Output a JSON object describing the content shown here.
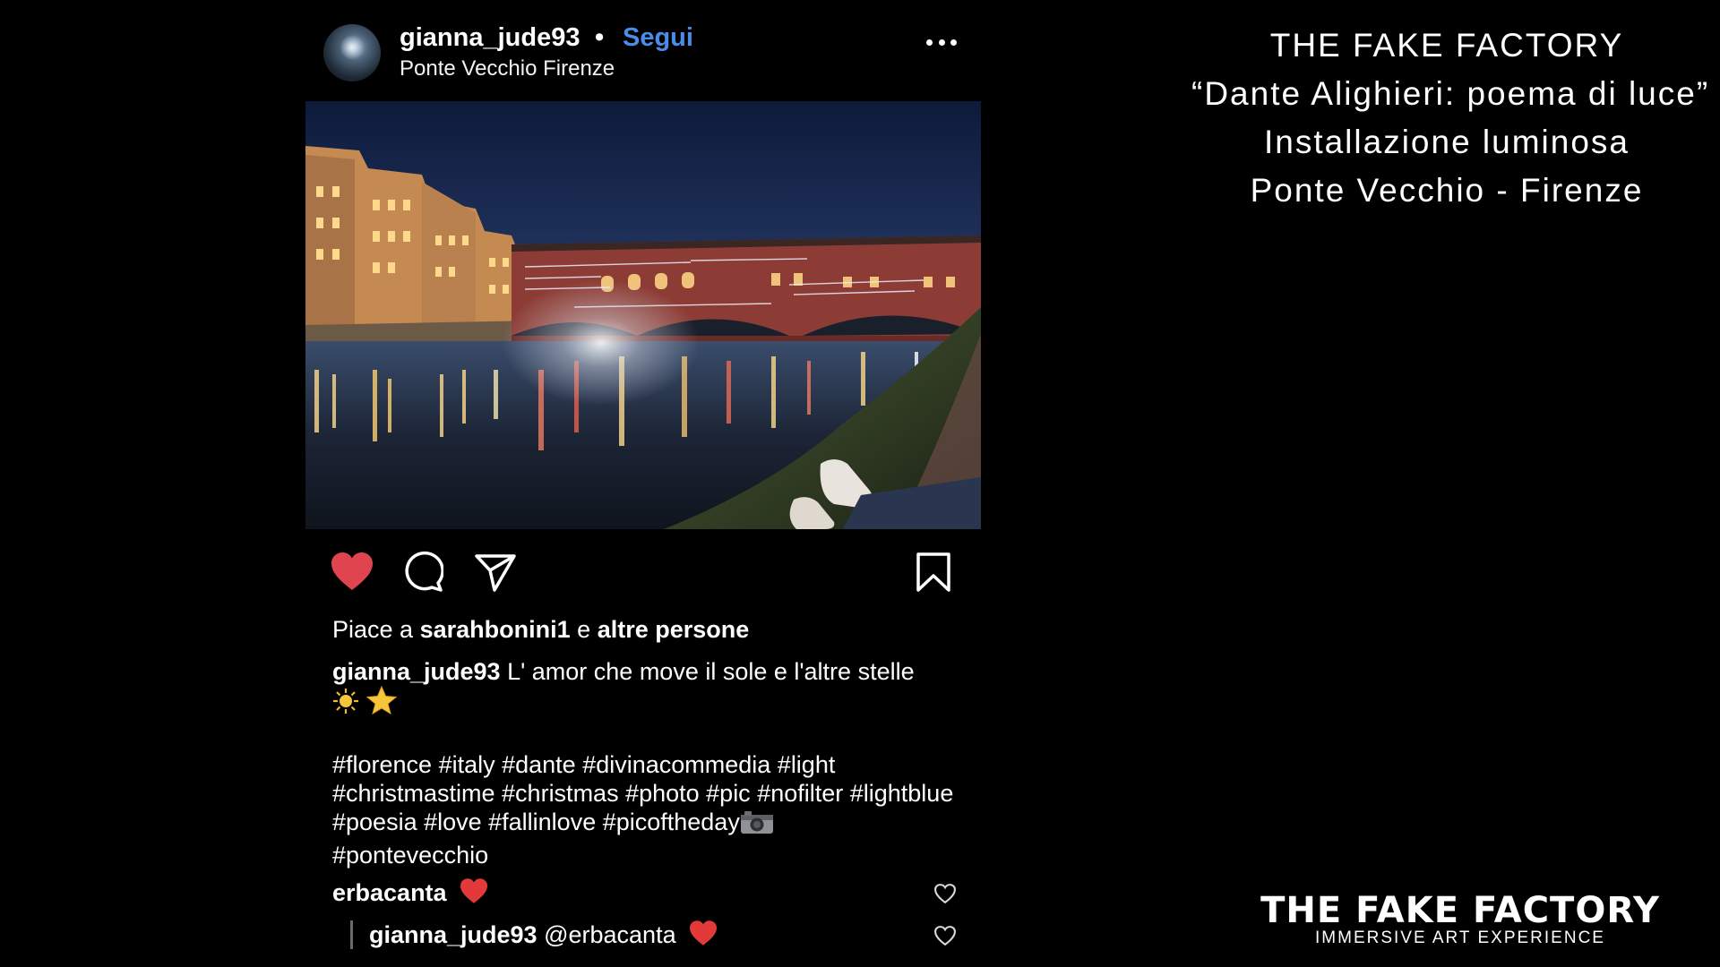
{
  "post": {
    "username": "gianna_jude93",
    "separator": "•",
    "follow_label": "Segui",
    "location": "Ponte Vecchio Firenze",
    "more_icon": "more-horizontal-icon",
    "photo_description_icon": "photo",
    "actions": {
      "like_icon": "heart-filled-icon",
      "like_color": "#e0454f",
      "comment_icon": "comment-bubble-icon",
      "share_icon": "paper-plane-icon",
      "save_icon": "bookmark-icon"
    },
    "likes": {
      "prefix": "Piace a",
      "user": "sarahbonini1",
      "joiner": "e",
      "others": "altre persone"
    },
    "caption": {
      "user": "gianna_jude93",
      "text": "L' amor che move il sole e l'altre stelle",
      "hashtags": "#florence #italy #dante #divinacommedia #light #christmastime #christmas #photo #pic #nofilter #lightblue #poesia #love #fallinlove #picoftheday",
      "hashtags_last": "#pontevecchio"
    },
    "comments": [
      {
        "user": "erbacanta",
        "text": ""
      },
      {
        "user": "gianna_jude93",
        "text": "@erbacanta"
      }
    ]
  },
  "overlay": {
    "title_lines": [
      "THE FAKE FACTORY",
      "“Dante Alighieri: poema di luce”",
      "Installazione luminosa",
      "Ponte Vecchio - Firenze"
    ],
    "logo_main": "THE FAKE FACTORY",
    "logo_sub": "IMMERSIVE ART EXPERIENCE"
  },
  "colors": {
    "background": "#000000",
    "follow": "#4a8de6",
    "heart": "#e0454f"
  }
}
